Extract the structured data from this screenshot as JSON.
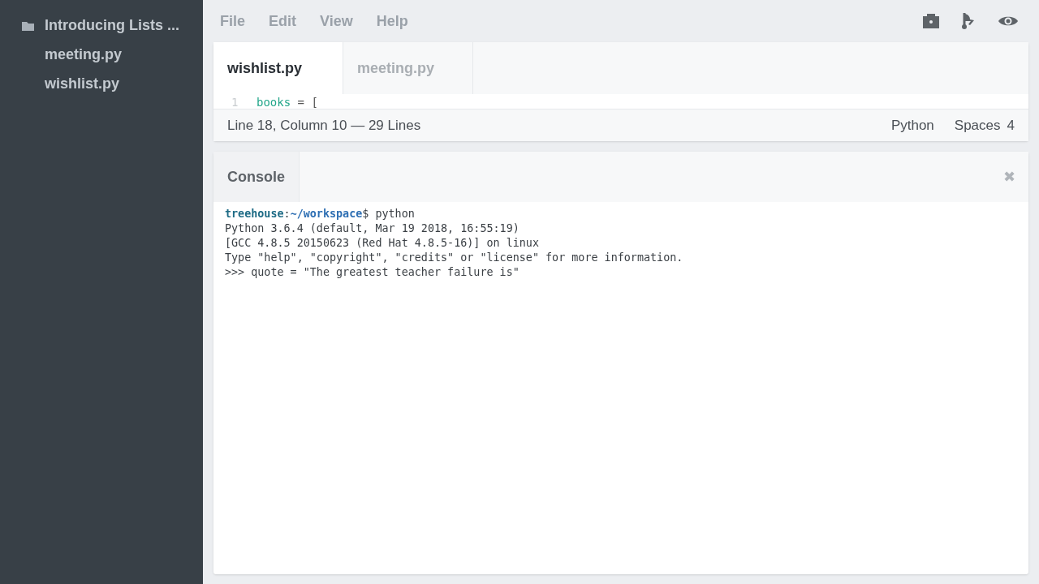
{
  "sidebar": {
    "folder": "Introducing Lists ...",
    "files": [
      "meeting.py",
      "wishlist.py"
    ]
  },
  "menu": [
    "File",
    "Edit",
    "View",
    "Help"
  ],
  "editor": {
    "tabs": [
      {
        "label": "wishlist.py",
        "selected": true
      },
      {
        "label": "meeting.py",
        "selected": false
      }
    ],
    "code_lines": [
      {
        "number": "1",
        "name": "books",
        "rest": " = ["
      }
    ],
    "status": {
      "position": "Line 18, Column 10 — 29 Lines",
      "language": "Python",
      "indent_label": "Spaces",
      "indent_size": "4"
    }
  },
  "console": {
    "title": "Console",
    "close": "✖",
    "prompt": {
      "user": "treehouse",
      "separator": ":",
      "path": "~/workspace",
      "command": "$ python"
    },
    "lines": [
      "Python 3.6.4 (default, Mar 19 2018, 16:55:19)",
      "[GCC 4.8.5 20150623 (Red Hat 4.8.5-16)] on linux",
      "Type \"help\", \"copyright\", \"credits\" or \"license\" for more information.",
      ">>> quote = \"The greatest teacher failure is\""
    ]
  }
}
